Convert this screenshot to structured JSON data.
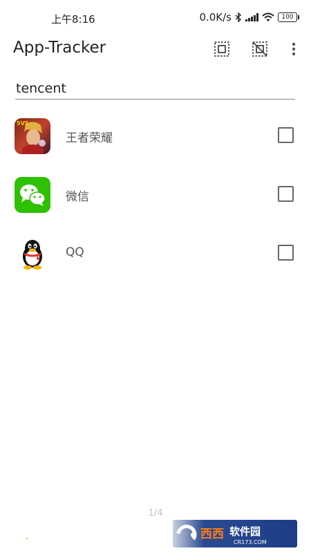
{
  "status_bar": {
    "time": "上午8:16",
    "network_speed": "0.0K/s",
    "battery": "100"
  },
  "toolbar": {
    "title": "App-Tracker",
    "icons": [
      "select-all-icon",
      "deselect-all-icon",
      "more-vert-icon"
    ]
  },
  "search": {
    "value": "tencent"
  },
  "apps": [
    {
      "name": "王者荣耀",
      "icon": "honor-of-kings-icon",
      "checked": false
    },
    {
      "name": "微信",
      "icon": "wechat-icon",
      "checked": false
    },
    {
      "name": "QQ",
      "icon": "qq-icon",
      "checked": false
    }
  ],
  "pager": "1/4",
  "watermark": {
    "text_cn": "西西软件园",
    "text_en": "CR173.COM"
  },
  "colors": {
    "wechat_green": "#2dc100",
    "qq_red": "#e8302a",
    "watermark_bg": "#1c3d86"
  }
}
